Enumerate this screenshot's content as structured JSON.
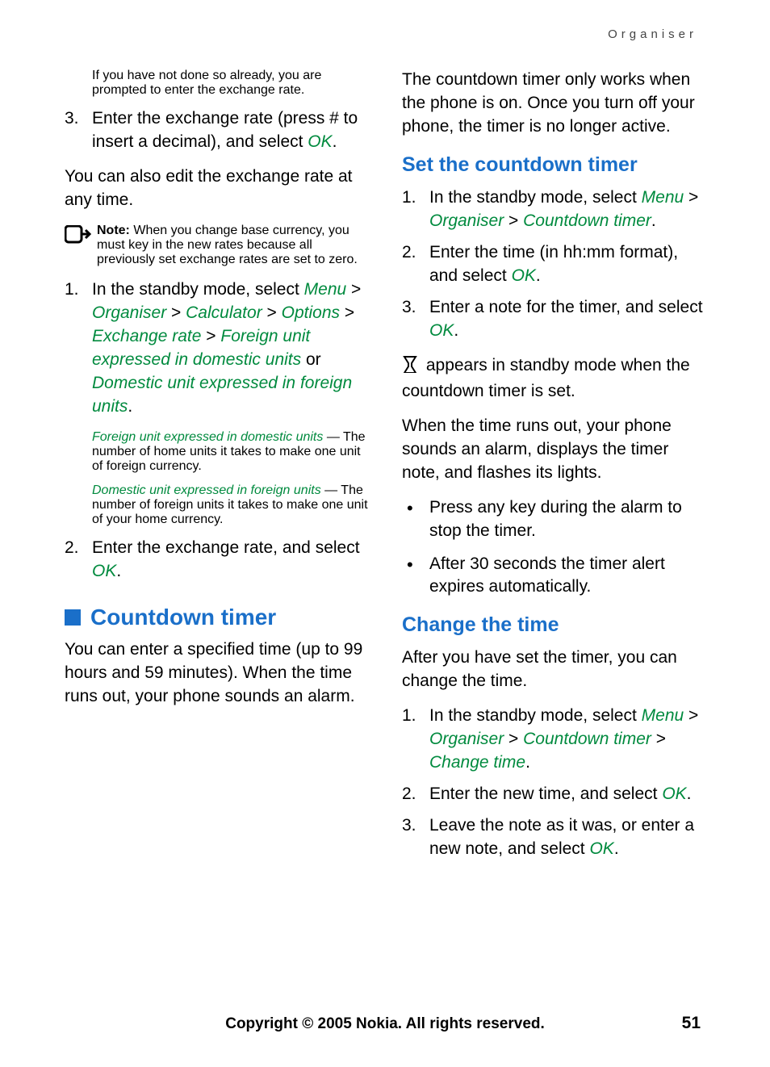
{
  "runningHeader": "Organiser",
  "col1": {
    "p1": "If you have not done so already, you are prompted to enter the exchange rate.",
    "step3_num": "3.",
    "step3_a": "Enter the exchange rate (press # to insert a decimal), and select ",
    "step3_b": "OK",
    "step3_c": ".",
    "p2": "You can also edit the exchange rate at any time.",
    "note_label": "Note:",
    "note_text": " When you change base currency, you must key in the new rates because all previously set exchange rates are set to zero.",
    "s1_num": "1.",
    "s1_a": "In the standby mode, select ",
    "s1_path1": "Menu",
    "s1_sep": " > ",
    "s1_path2": "Organiser",
    "s1_path3": "Calculator",
    "s1_path4": "Options",
    "s1_path5": "Exchange rate",
    "s1_path6": "Foreign unit expressed in domestic units",
    "s1_or": " or ",
    "s1_path7": "Domestic unit expressed in foreign units",
    "s1_end": ".",
    "sub1_a": "Foreign unit expressed in domestic units",
    "sub1_b": " — The number of home units it takes to make one unit of foreign currency.",
    "sub2_a": "Domestic unit expressed in foreign units",
    "sub2_b": " — The number of foreign units it takes to make one unit of your home currency.",
    "s2_num": "2.",
    "s2_a": "Enter the exchange rate, and select ",
    "s2_b": "OK",
    "s2_c": ".",
    "h1": "Countdown timer",
    "p3": "You can enter a specified time (up to 99 hours and 59 minutes). When the time runs out, your phone sounds an alarm."
  },
  "col2": {
    "p1": "The countdown timer only works when the phone is on. Once you turn off your phone, the timer is no longer active.",
    "h2a": "Set the countdown timer",
    "a1_num": "1.",
    "a1_a": "In the standby mode, select ",
    "a1_p1": "Menu",
    "sep": " > ",
    "a1_p2": "Organiser",
    "a1_p3": "Countdown timer",
    "a1_end": ".",
    "a2_num": "2.",
    "a2_a": "Enter the time (in hh:mm format), and select ",
    "a2_b": "OK",
    "a2_c": ".",
    "a3_num": "3.",
    "a3_a": "Enter a note for the timer, and select ",
    "a3_b": "OK",
    "a3_c": ".",
    "p2_b": " appears in standby mode when the countdown timer is set.",
    "p3": "When the time runs out, your phone sounds an alarm, displays the timer note, and flashes its lights.",
    "b1": "Press any key during the alarm to stop the timer.",
    "b2": "After 30 seconds the timer alert expires automatically.",
    "h2b": "Change the time",
    "p4": "After you have set the timer, you can change the time.",
    "c1_num": "1.",
    "c1_a": "In the standby mode, select ",
    "c1_p1": "Menu",
    "c1_p2": "Organiser",
    "c1_p3": "Countdown timer",
    "c1_p4": "Change time",
    "c1_end": ".",
    "c2_num": "2.",
    "c2_a": "Enter the new time, and select ",
    "c2_b": "OK",
    "c2_c": ".",
    "c3_num": "3.",
    "c3_a": "Leave the note as it was, or enter a new note, and select ",
    "c3_b": "OK",
    "c3_c": "."
  },
  "footer": "Copyright © 2005 Nokia. All rights reserved.",
  "pageNum": "51"
}
